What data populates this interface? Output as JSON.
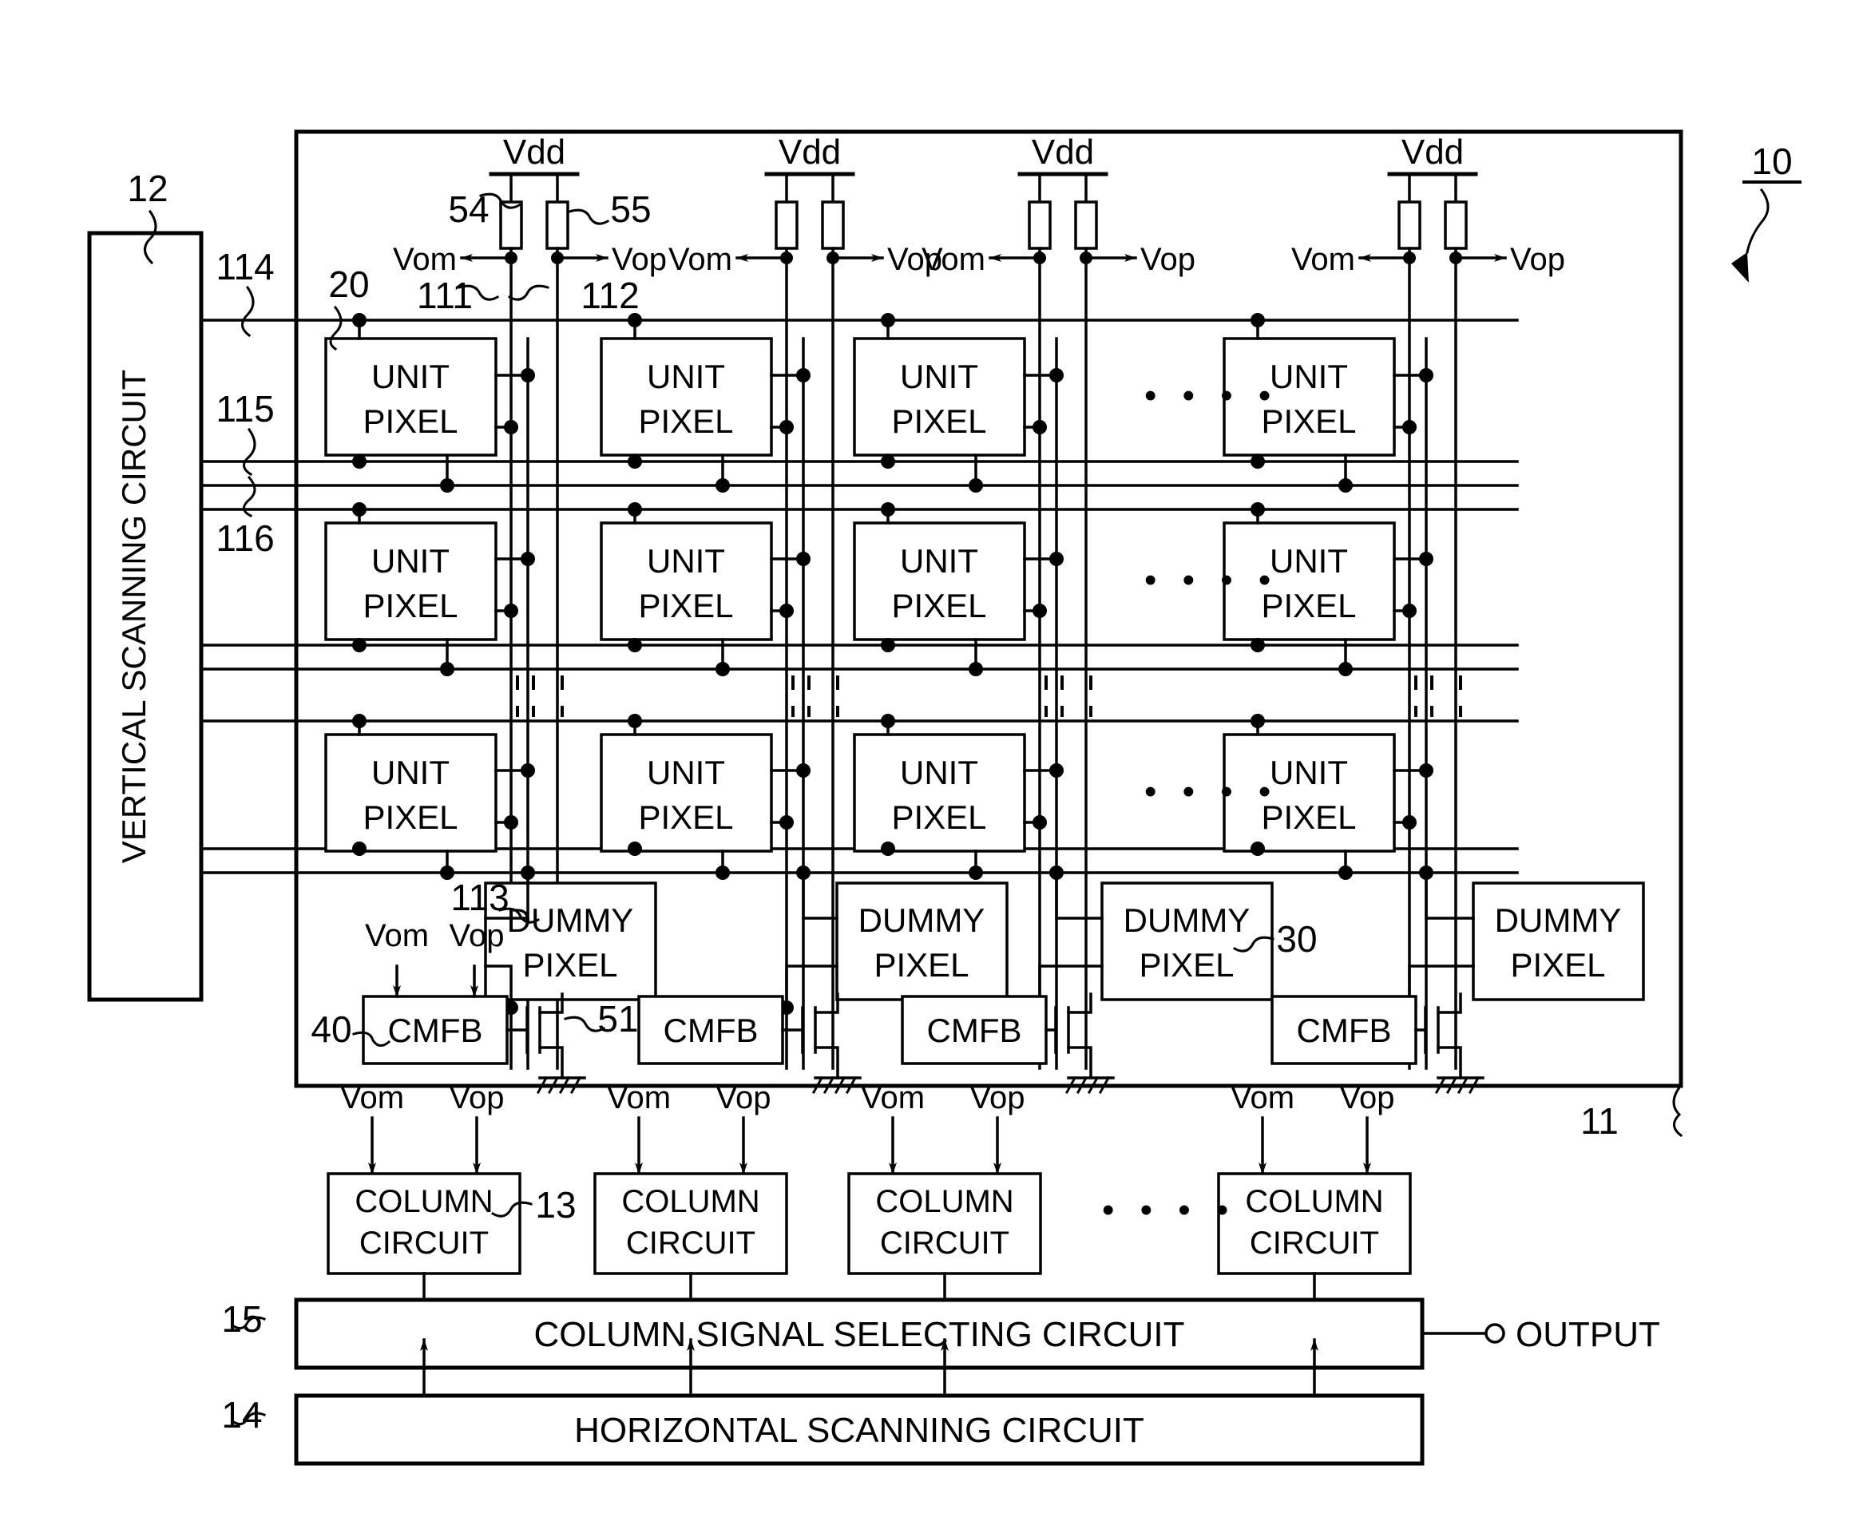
{
  "figure": {
    "ref_main": "10",
    "ref_pixel_area": "11",
    "ref_vertical_scanning": "12",
    "ref_column_circuit": "13",
    "ref_horizontal_scanning": "14",
    "ref_column_signal_selecting": "15",
    "ref_unit_pixel": "20",
    "ref_dummy_pixel": "30",
    "ref_cmfb": "40",
    "ref_current_source_transistor": "51",
    "ref_load_resistor_m": "54",
    "ref_load_resistor_p": "55",
    "ref_vertical_signal_line_m": "111",
    "ref_vertical_signal_line_p": "112",
    "ref_vertical_signal_line_dummy": "113",
    "ref_row_line_1": "114",
    "ref_row_line_2": "115",
    "ref_row_line_3": "116"
  },
  "blocks": {
    "vertical_scanning_circuit": "VERTICAL SCANNING CIRCUIT",
    "unit_pixel_line1": "UNIT",
    "unit_pixel_line2": "PIXEL",
    "dummy_pixel_line1": "DUMMY",
    "dummy_pixel_line2": "PIXEL",
    "cmfb": "CMFB",
    "column_circuit_line1": "COLUMN",
    "column_circuit_line2": "CIRCUIT",
    "column_signal_selecting_circuit": "COLUMN SIGNAL SELECTING CIRCUIT",
    "horizontal_scanning_circuit": "HORIZONTAL SCANNING CIRCUIT"
  },
  "signals": {
    "vdd": "Vdd",
    "vom": "Vom",
    "vop": "Vop",
    "output": "OUTPUT",
    "ellipsis_horizontal": "• • • •"
  },
  "columns": [
    {
      "index": 0,
      "vdd": "Vdd",
      "vom": "Vom",
      "vop": "Vop"
    },
    {
      "index": 1,
      "vdd": "Vdd",
      "vom": "Vom",
      "vop": "Vop"
    },
    {
      "index": 2,
      "vdd": "Vdd",
      "vom": "Vom",
      "vop": "Vop"
    },
    {
      "index": 3,
      "vdd": "Vdd",
      "vom": "Vom",
      "vop": "Vop"
    }
  ],
  "column_circuits": [
    {
      "vom": "Vom",
      "vop": "Vop",
      "line1": "COLUMN",
      "line2": "CIRCUIT"
    },
    {
      "vom": "Vom",
      "vop": "Vop",
      "line1": "COLUMN",
      "line2": "CIRCUIT"
    },
    {
      "vom": "Vom",
      "vop": "Vop",
      "line1": "COLUMN",
      "line2": "CIRCUIT"
    },
    {
      "vom": "Vom",
      "vop": "Vop",
      "line1": "COLUMN",
      "line2": "CIRCUIT"
    }
  ],
  "cmfb_inputs": {
    "vom": "Vom",
    "vop": "Vop"
  },
  "colors": {
    "stroke": "#000000",
    "background": "#ffffff"
  }
}
